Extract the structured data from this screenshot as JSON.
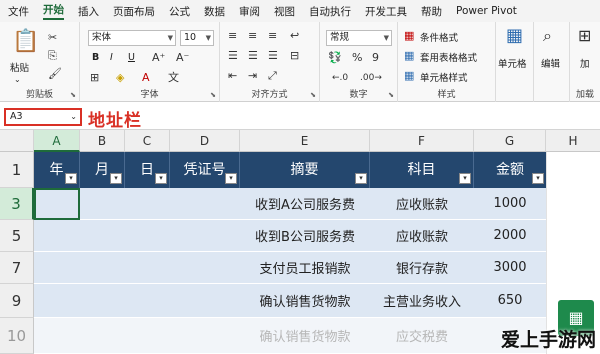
{
  "menu": {
    "tabs": [
      "文件",
      "开始",
      "插入",
      "页面布局",
      "公式",
      "数据",
      "审阅",
      "视图",
      "自动执行",
      "开发工具",
      "帮助",
      "Power Pivot"
    ],
    "active_tab": "开始"
  },
  "ribbon": {
    "clipboard": {
      "paste_label": "粘贴",
      "group_label": "剪贴板"
    },
    "font": {
      "font_name": "宋体",
      "font_size": "10",
      "bold": "B",
      "italic": "I",
      "underline": "U",
      "group_label": "字体"
    },
    "alignment": {
      "group_label": "对齐方式"
    },
    "number": {
      "format": "常规",
      "group_label": "数字"
    },
    "styles": {
      "conditional": "条件格式",
      "table_format": "套用表格格式",
      "cell_styles": "单元格样式",
      "group_label": "样式"
    },
    "cells": {
      "label": "单元格"
    },
    "editing": {
      "label": "编辑"
    },
    "addins": {
      "label": "加",
      "group_label": "加载"
    }
  },
  "formula_bar": {
    "name_box": "A3",
    "annotation": "地址栏"
  },
  "grid": {
    "columns": [
      "A",
      "B",
      "C",
      "D",
      "E",
      "F",
      "G",
      "H"
    ],
    "selected_column": "A",
    "row_numbers": [
      "1",
      "3",
      "5",
      "7",
      "9",
      "10"
    ],
    "selected_row": "3",
    "headers": [
      "年",
      "月",
      "日",
      "凭证号",
      "摘要",
      "科目",
      "金额"
    ],
    "rows": [
      {
        "summary": "收到A公司服务费",
        "account": "应收账款",
        "amount": "1000"
      },
      {
        "summary": "收到B公司服务费",
        "account": "应收账款",
        "amount": "2000"
      },
      {
        "summary": "支付员工报销款",
        "account": "银行存款",
        "amount": "3000"
      },
      {
        "summary": "确认销售货物款",
        "account": "主营业务收入",
        "amount": "650"
      },
      {
        "summary": "确认销售货物款",
        "account": "应交税费",
        "amount": ""
      }
    ]
  },
  "watermark": {
    "text": "爱上手游网"
  }
}
